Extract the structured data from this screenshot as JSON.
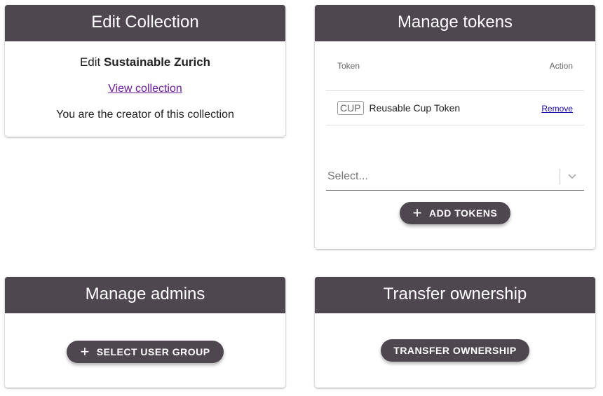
{
  "edit_collection": {
    "title": "Edit Collection",
    "edit_prefix": "Edit",
    "collection_name": "Sustainable Zurich",
    "view_link": "View collection",
    "creator_text": "You are the creator of this collection"
  },
  "manage_tokens": {
    "title": "Manage tokens",
    "columns": [
      "Token",
      "Action"
    ],
    "rows": [
      {
        "badge": "CUP",
        "name": "Reusable Cup Token",
        "action": "Remove"
      }
    ],
    "select_placeholder": "Select...",
    "add_button": "ADD TOKENS"
  },
  "manage_admins": {
    "title": "Manage admins",
    "button": "SELECT USER GROUP"
  },
  "transfer_ownership": {
    "title": "Transfer ownership",
    "button": "TRANSFER OWNERSHIP"
  },
  "colors": {
    "header_bg": "#4f4750",
    "link": "#6a1b9a"
  }
}
